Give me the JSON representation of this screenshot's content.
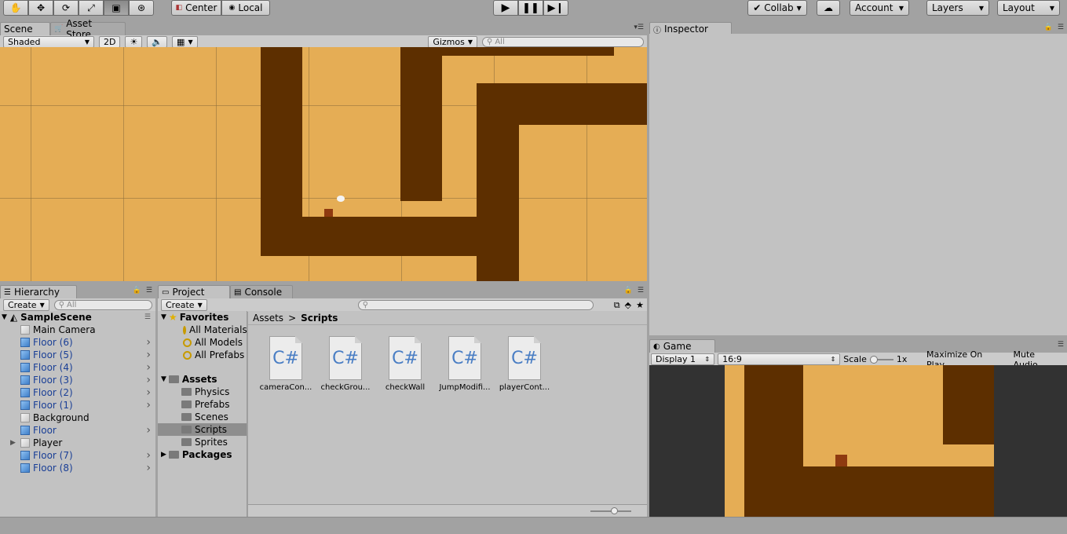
{
  "toolbar": {
    "pivot_center": "Center",
    "pivot_local": "Local",
    "collab": "Collab",
    "account": "Account",
    "layers": "Layers",
    "layout": "Layout"
  },
  "scene": {
    "tab_scene": "Scene",
    "tab_asset_store": "Asset Store",
    "shading_mode": "Shaded",
    "mode_2d": "2D",
    "gizmos": "Gizmos",
    "search_placeholder": "All"
  },
  "inspector": {
    "tab": "Inspector"
  },
  "hierarchy": {
    "tab": "Hierarchy",
    "create": "Create",
    "search_placeholder": "All",
    "scene_name": "SampleScene",
    "items": [
      {
        "label": "Main Camera",
        "blue": false,
        "arrow": false
      },
      {
        "label": "Floor (6)",
        "blue": true,
        "arrow": true
      },
      {
        "label": "Floor (5)",
        "blue": true,
        "arrow": true
      },
      {
        "label": "Floor (4)",
        "blue": true,
        "arrow": true
      },
      {
        "label": "Floor (3)",
        "blue": true,
        "arrow": true
      },
      {
        "label": "Floor (2)",
        "blue": true,
        "arrow": true
      },
      {
        "label": "Floor (1)",
        "blue": true,
        "arrow": true
      },
      {
        "label": "Background",
        "blue": false,
        "arrow": false
      },
      {
        "label": "Floor",
        "blue": true,
        "arrow": true
      },
      {
        "label": "Player",
        "blue": false,
        "arrow": false
      },
      {
        "label": "Floor (7)",
        "blue": true,
        "arrow": true
      },
      {
        "label": "Floor (8)",
        "blue": true,
        "arrow": true
      }
    ]
  },
  "project": {
    "tab_project": "Project",
    "tab_console": "Console",
    "create": "Create",
    "favorites": "Favorites",
    "fav_items": [
      "All Materials",
      "All Models",
      "All Prefabs"
    ],
    "assets": "Assets",
    "asset_folders": [
      "Physics",
      "Prefabs",
      "Scenes",
      "Scripts",
      "Sprites"
    ],
    "packages": "Packages",
    "breadcrumb_root": "Assets",
    "breadcrumb_sep": ">",
    "breadcrumb_current": "Scripts",
    "files": [
      "cameraCon...",
      "checkGrou...",
      "checkWall",
      "JumpModifi...",
      "playerCont..."
    ],
    "file_icon_text": "C#"
  },
  "game": {
    "tab": "Game",
    "display": "Display 1",
    "aspect": "16:9",
    "scale_label": "Scale",
    "scale_value": "1x",
    "maximize": "Maximize On Play",
    "mute": "Mute Audio"
  },
  "colors": {
    "sand": "#e5ad55",
    "wall": "#5d2f00",
    "player": "#8e3a10",
    "editor_bg": "#c2c2c2"
  }
}
